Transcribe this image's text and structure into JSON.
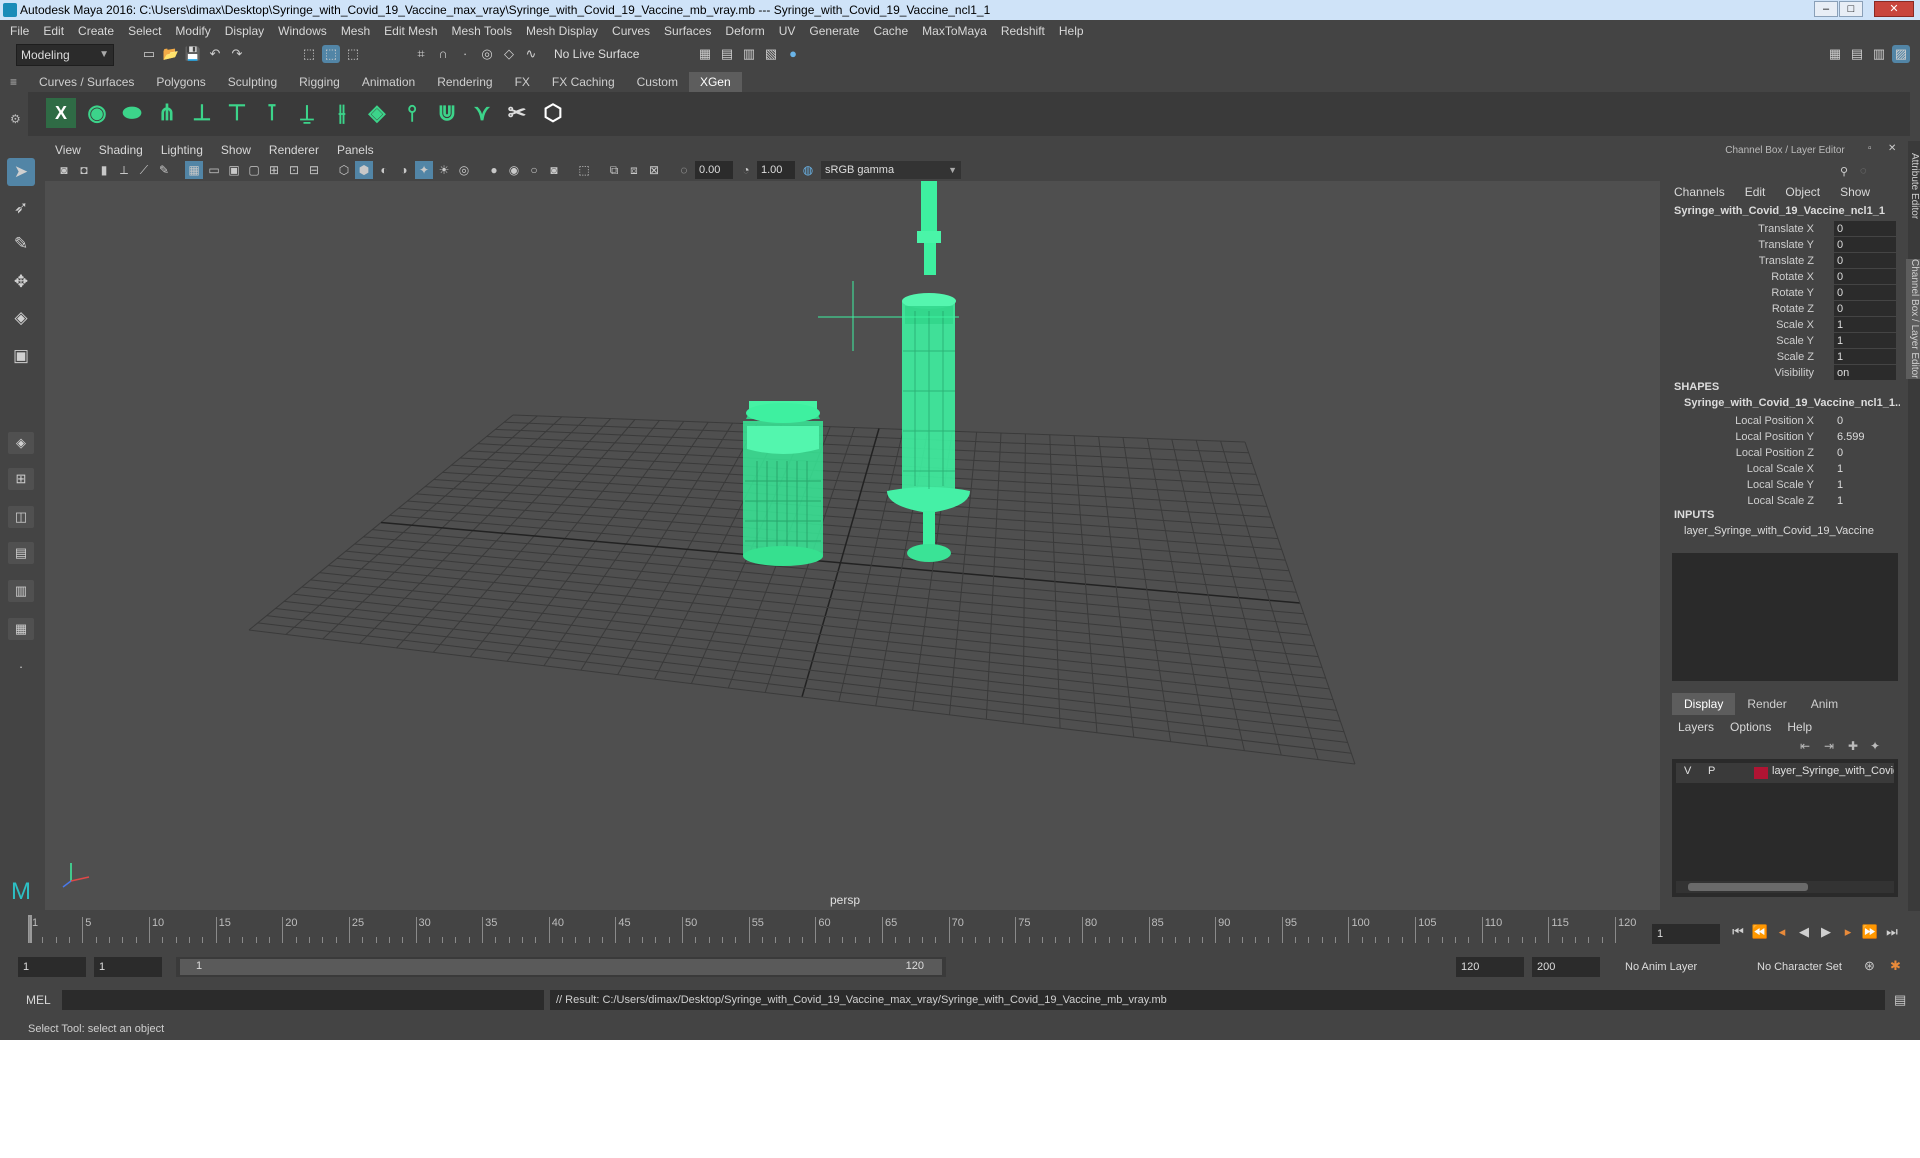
{
  "window": {
    "title": "Autodesk Maya 2016: C:\\Users\\dimax\\Desktop\\Syringe_with_Covid_19_Vaccine_max_vray\\Syringe_with_Covid_19_Vaccine_mb_vray.mb   ---   Syringe_with_Covid_19_Vaccine_ncl1_1",
    "minimize": "–",
    "maximize": "□",
    "close": "✕"
  },
  "menubar": [
    "File",
    "Edit",
    "Create",
    "Select",
    "Modify",
    "Display",
    "Windows",
    "Mesh",
    "Edit Mesh",
    "Mesh Tools",
    "Mesh Display",
    "Curves",
    "Surfaces",
    "Deform",
    "UV",
    "Generate",
    "Cache",
    "MaxToMaya",
    "Redshift",
    "Help"
  ],
  "statusline": {
    "mode": "Modeling",
    "live_surface": "No Live Surface"
  },
  "shelf": {
    "tabs": [
      "Curves / Surfaces",
      "Polygons",
      "Sculpting",
      "Rigging",
      "Animation",
      "Rendering",
      "FX",
      "FX Caching",
      "Custom",
      "XGen"
    ],
    "active_tab": "XGen"
  },
  "viewport": {
    "menu": [
      "View",
      "Shading",
      "Lighting",
      "Show",
      "Renderer",
      "Panels"
    ],
    "exposure": "0.00",
    "gamma": "1.00",
    "color_space": "sRGB gamma",
    "camera_label": "persp"
  },
  "channel_box": {
    "panel_title": "Channel Box / Layer Editor",
    "menu": [
      "Channels",
      "Edit",
      "Object",
      "Show"
    ],
    "object_name": "Syringe_with_Covid_19_Vaccine_ncl1_1",
    "attributes": [
      {
        "name": "Translate X",
        "value": "0"
      },
      {
        "name": "Translate Y",
        "value": "0"
      },
      {
        "name": "Translate Z",
        "value": "0"
      },
      {
        "name": "Rotate X",
        "value": "0"
      },
      {
        "name": "Rotate Y",
        "value": "0"
      },
      {
        "name": "Rotate Z",
        "value": "0"
      },
      {
        "name": "Scale X",
        "value": "1"
      },
      {
        "name": "Scale Y",
        "value": "1"
      },
      {
        "name": "Scale Z",
        "value": "1"
      },
      {
        "name": "Visibility",
        "value": "on"
      }
    ],
    "shapes_header": "SHAPES",
    "shape_name": "Syringe_with_Covid_19_Vaccine_ncl1_1...",
    "shape_attributes": [
      {
        "name": "Local Position X",
        "value": "0"
      },
      {
        "name": "Local Position Y",
        "value": "6.599"
      },
      {
        "name": "Local Position Z",
        "value": "0"
      },
      {
        "name": "Local Scale X",
        "value": "1"
      },
      {
        "name": "Local Scale Y",
        "value": "1"
      },
      {
        "name": "Local Scale Z",
        "value": "1"
      }
    ],
    "inputs_header": "INPUTS",
    "input_name": "layer_Syringe_with_Covid_19_Vaccine"
  },
  "layer_editor": {
    "tabs": [
      "Display",
      "Render",
      "Anim"
    ],
    "active_tab": "Display",
    "menu": [
      "Layers",
      "Options",
      "Help"
    ],
    "layer": {
      "v": "V",
      "p": "P",
      "name": "layer_Syringe_with_Covid",
      "color": "#b01433"
    }
  },
  "side_tabs": [
    "Attribute Editor",
    "Channel Box / Layer Editor"
  ],
  "timeline": {
    "ticks": [
      "1",
      "5",
      "10",
      "15",
      "20",
      "25",
      "30",
      "35",
      "40",
      "45",
      "50",
      "55",
      "60",
      "65",
      "70",
      "75",
      "80",
      "85",
      "90",
      "95",
      "100",
      "105",
      "110",
      "115",
      "120"
    ],
    "current_frame": "1"
  },
  "range": {
    "start": "1",
    "playback_start": "1",
    "slider_start": "1",
    "slider_end": "120",
    "playback_end": "120",
    "end": "200",
    "anim_layer": "No Anim Layer",
    "character_set": "No Character Set"
  },
  "command": {
    "mel_label": "MEL",
    "result": "// Result: C:/Users/dimax/Desktop/Syringe_with_Covid_19_Vaccine_max_vray/Syringe_with_Covid_19_Vaccine_mb_vray.mb"
  },
  "help_line": "Select Tool: select an object",
  "colors": {
    "wireframe": "#3ef0a0",
    "grid": "#3a3a3a",
    "active_tool": "#5285a6"
  }
}
